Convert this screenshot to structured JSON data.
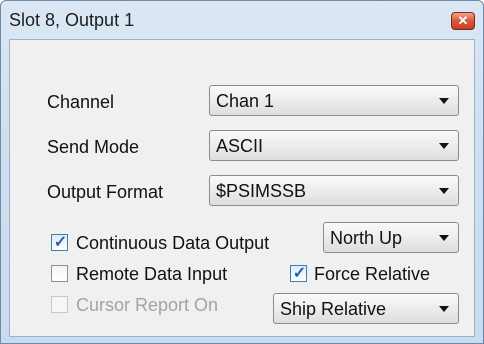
{
  "window": {
    "title": "Slot 8, Output 1"
  },
  "fields": {
    "channel": {
      "label": "Channel",
      "value": "Chan 1"
    },
    "send_mode": {
      "label": "Send Mode",
      "value": "ASCII"
    },
    "output_format": {
      "label": "Output Format",
      "value": "$PSIMSSB"
    }
  },
  "options": {
    "continuous": {
      "label": "Continuous Data Output",
      "checked": true
    },
    "orientation": {
      "value": "North Up"
    },
    "remote_input": {
      "label": "Remote Data Input",
      "checked": false
    },
    "force_relative": {
      "label": "Force Relative",
      "checked": true
    },
    "cursor_report": {
      "label": "Cursor Report On",
      "checked": false,
      "enabled": false
    },
    "reference": {
      "value": "Ship Relative"
    }
  },
  "icons": {
    "close": "close-icon",
    "dropdown": "chevron-down-icon",
    "check": "checkmark-icon"
  },
  "colors": {
    "titlebar": "#cfdff0",
    "client": "#f0f0f0",
    "close_button": "#d9583a",
    "check": "#2a5ea8"
  }
}
